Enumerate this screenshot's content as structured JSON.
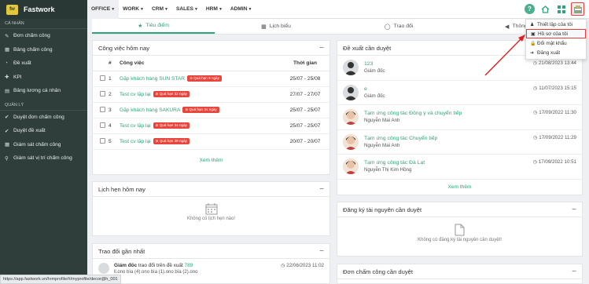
{
  "brand": {
    "logo": "fw",
    "name": "Fastwork"
  },
  "sidebar": {
    "section_personal": "CÁ NHÂN",
    "items_personal": [
      {
        "icon": "✎",
        "label": "Đơn chấm công"
      },
      {
        "icon": "▦",
        "label": "Bảng chấm công"
      },
      {
        "icon": "◔",
        "label": "Đề xuất"
      },
      {
        "icon": "✚",
        "label": "KPI"
      },
      {
        "icon": "▤",
        "label": "Bảng lương cá nhân"
      }
    ],
    "section_manage": "QUẢN LÝ",
    "items_manage": [
      {
        "icon": "✔",
        "label": "Duyệt đơn chấm công"
      },
      {
        "icon": "✔",
        "label": "Duyệt đề xuất"
      },
      {
        "icon": "▦",
        "label": "Giám sát chấm công"
      },
      {
        "icon": "⚲",
        "label": "Giám sát vị trí chấm công"
      }
    ]
  },
  "topmenu": [
    "OFFICE",
    "WORK",
    "CRM",
    "SALES",
    "HRM",
    "ADMIN"
  ],
  "tabs": [
    {
      "icon": "★",
      "label": "Tiêu điểm"
    },
    {
      "icon": "▦",
      "label": "Lịch biểu"
    },
    {
      "icon": "◯",
      "label": "Trao đổi"
    },
    {
      "icon": "◀",
      "label": "Thông báo"
    }
  ],
  "tasks": {
    "title": "Công việc hôm nay",
    "col_num": "#",
    "col_task": "Công việc",
    "col_time": "Thời gian",
    "rows": [
      {
        "n": "1",
        "name": "Gặp khách hàng SUN STAR",
        "badge": "Quá hạn 9 ngày",
        "time": "25/07 - 25/08"
      },
      {
        "n": "2",
        "name": "Test cv lặp lại",
        "badge": "Quá hạn 32 ngày",
        "time": "27/07 - 27/07"
      },
      {
        "n": "3",
        "name": "Gặp khách hàng SAKURA",
        "badge": "Quá hạn 34 ngày",
        "time": "25/07 - 25/07"
      },
      {
        "n": "4",
        "name": "Test cv lặp lại",
        "badge": "Quá hạn 34 ngày",
        "time": "25/07 - 25/07"
      },
      {
        "n": "5",
        "name": "Test cv lặp lại",
        "badge": "Quá hạn 39 ngày",
        "time": "20/07 - 20/07"
      }
    ],
    "more": "Xem thêm"
  },
  "meetings": {
    "title": "Lịch hẹn hôm nay",
    "empty": "Không có lịch hẹn nào!"
  },
  "recent": {
    "title": "Trao đổi gần nhất",
    "who": "Giám đốc",
    "action": " trao đổi trên đề xuất ",
    "ref": "789",
    "time": "22/06/2023 11:02",
    "sub": "ll.ono bìa (4).ono bìa (1).ono bìa (2).ono"
  },
  "proposals": {
    "title": "Đề xuất cần duyệt",
    "rows": [
      {
        "title": "123",
        "sub": "Giám đốc",
        "time": "21/08/2023 13:44",
        "av": "gray"
      },
      {
        "title": "e",
        "sub": "Giám đốc",
        "time": "11/07/2023 15:15",
        "av": "gray"
      },
      {
        "title": "Tạm ứng công tác Đông ý và chuyển tiếp",
        "sub": "Nguyễn Mai Anh",
        "time": "17/09/2022 11:30",
        "av": "photo"
      },
      {
        "title": "Tạm ứng công tác Chuyển tiếp",
        "sub": "Nguyễn Mai Anh",
        "time": "17/09/2022 11:29",
        "av": "photo"
      },
      {
        "title": "Tạm ứng công tác Đà Lạt",
        "sub": "Nguyễn Thị Kim Hồng",
        "time": "17/09/2022 10:51",
        "av": "photo"
      }
    ],
    "more": "Xem thêm"
  },
  "resources": {
    "title": "Đăng ký tài nguyên cần duyệt",
    "empty": "Không có đăng ký tài nguyên cần duyệt!"
  },
  "timesheets": {
    "title": "Đơn chấm công cần duyệt"
  },
  "dropdown": [
    {
      "icon": "♟",
      "label": "Thiết lập của tôi"
    },
    {
      "icon": "▣",
      "label": "Hồ sơ của tôi"
    },
    {
      "icon": "🔒",
      "label": "Đổi mật khẩu"
    },
    {
      "icon": "➜",
      "label": "Đăng xuất"
    }
  ],
  "statusbar": "https://app.fastwork.vn/hrmprofile/#/myprofile/decor@h_001",
  "colors": {
    "accent": "#2fa37d",
    "sidebar": "#2f3e3b",
    "badge": "#e8453c",
    "highlight": "#e63c3c"
  }
}
